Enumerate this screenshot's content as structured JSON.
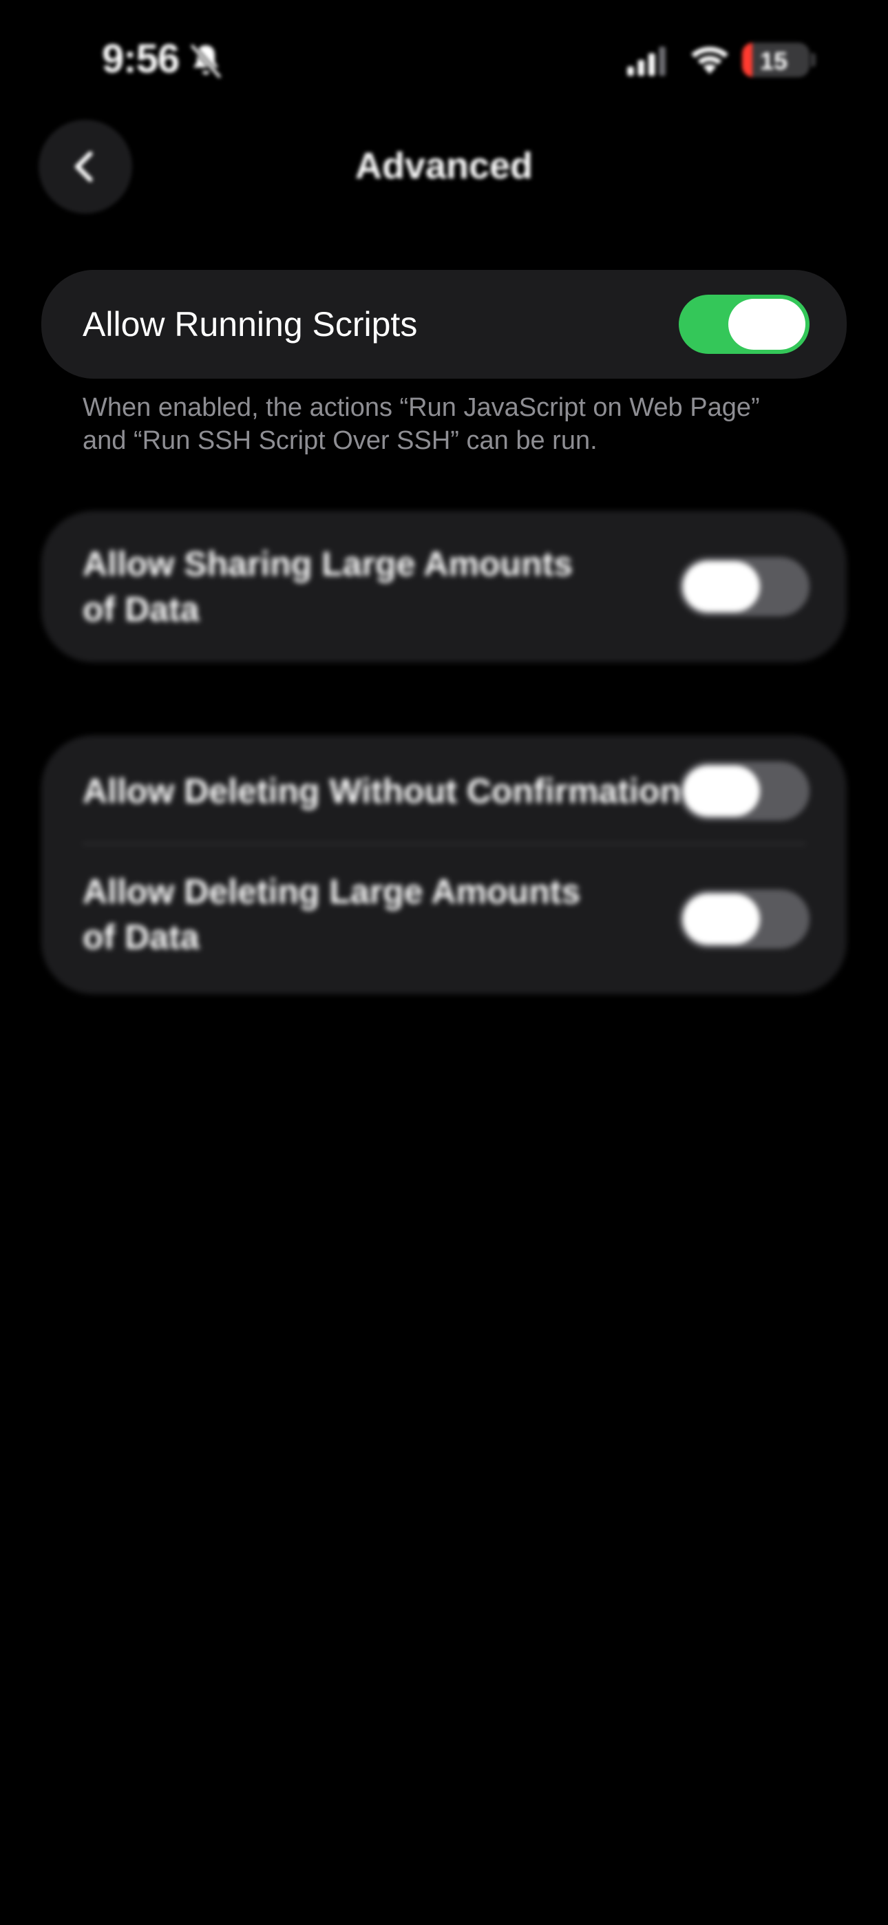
{
  "status_bar": {
    "time": "9:56",
    "silent_icon": "bell-slash-icon",
    "signal_icon": "cellular-signal-icon",
    "wifi_icon": "wifi-icon",
    "battery_level": "15",
    "battery_color": "#ff3b30"
  },
  "nav": {
    "back_icon": "chevron-left-icon",
    "title": "Advanced"
  },
  "sections": [
    {
      "rows": [
        {
          "label": "Allow Running Scripts",
          "enabled": true
        }
      ],
      "footer": "When enabled, the actions “Run JavaScript on Web Page” and “Run SSH Script Over SSH” can be run."
    },
    {
      "rows": [
        {
          "label_line1": "Allow Sharing Large Amounts",
          "label_line2": "of Data",
          "enabled": false
        }
      ]
    },
    {
      "rows": [
        {
          "label": "Allow Deleting Without Confirmation",
          "enabled": false
        },
        {
          "label_line1": "Allow Deleting Large Amounts",
          "label_line2": "of Data",
          "enabled": false
        }
      ]
    }
  ],
  "colors": {
    "background": "#000000",
    "card": "#1c1c1e",
    "toggle_on": "#34c759",
    "toggle_off": "#5a5a5e",
    "footer_text": "#8e8e93"
  }
}
